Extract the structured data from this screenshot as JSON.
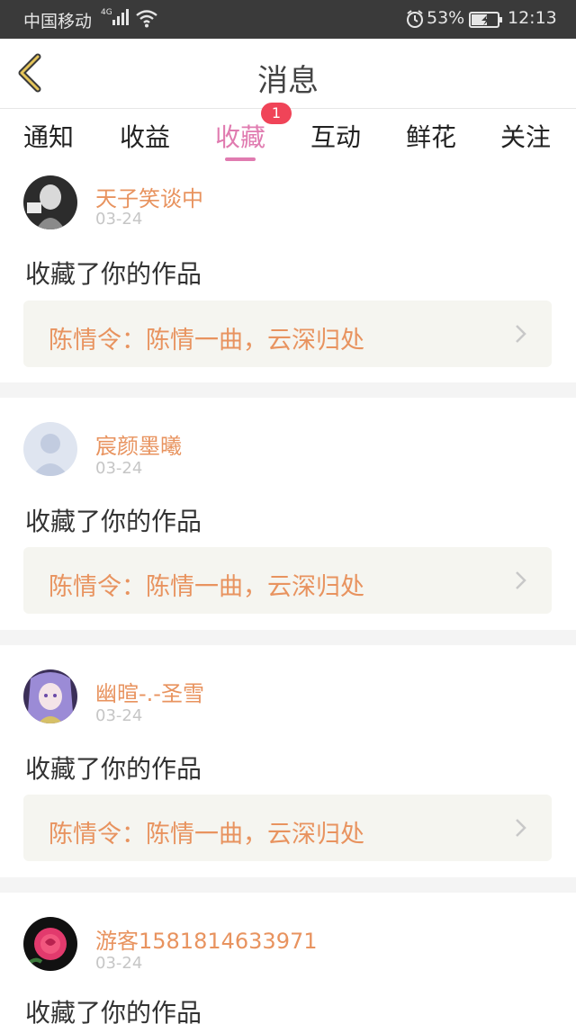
{
  "status_bar": {
    "carrier": "中国移动",
    "network": "4G",
    "battery_percent": "53%",
    "time": "12:13"
  },
  "header": {
    "title": "消息",
    "back_icon": "chevron-left-icon"
  },
  "tabs": [
    {
      "label": "通知",
      "active": false
    },
    {
      "label": "收益",
      "active": false
    },
    {
      "label": "收藏",
      "active": true,
      "badge": "1"
    },
    {
      "label": "互动",
      "active": false
    },
    {
      "label": "鲜花",
      "active": false
    },
    {
      "label": "关注",
      "active": false
    }
  ],
  "colors": {
    "accent": "#e07bb0",
    "username": "#e8935f",
    "badge": "#f04458"
  },
  "messages": [
    {
      "user": "天子笑谈中",
      "date": "03-24",
      "action": "收藏了你的作品",
      "work": "陈情令：陈情一曲，云深归处"
    },
    {
      "user": "宸颜墨曦",
      "date": "03-24",
      "action": "收藏了你的作品",
      "work": "陈情令：陈情一曲，云深归处"
    },
    {
      "user": "幽暄-.-圣雪",
      "date": "03-24",
      "action": "收藏了你的作品",
      "work": "陈情令：陈情一曲，云深归处"
    },
    {
      "user": "游客1581814633971",
      "date": "03-24",
      "action": "收藏了你的作品"
    }
  ]
}
